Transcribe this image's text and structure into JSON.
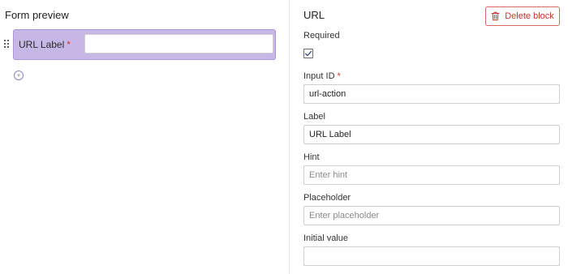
{
  "preview": {
    "title": "Form preview",
    "block": {
      "label": "URL Label",
      "required_mark": "*",
      "value": ""
    },
    "drag_icon": "drag-handle-icon",
    "add_icon": "add-circle-icon"
  },
  "editor": {
    "title": "URL",
    "delete_label": "Delete block",
    "delete_icon": "trash-icon",
    "required": {
      "label": "Required",
      "checked": true
    },
    "input_id": {
      "label": "Input ID",
      "required_mark": "*",
      "value": "url-action"
    },
    "label_field": {
      "label": "Label",
      "value": "URL Label"
    },
    "hint": {
      "label": "Hint",
      "placeholder": "Enter hint"
    },
    "placeholder_field": {
      "label": "Placeholder",
      "placeholder": "Enter placeholder"
    },
    "initial_value": {
      "label": "Initial value",
      "value": ""
    }
  },
  "colors": {
    "block_fill": "#c7b7e6",
    "delete_red": "#c0392b",
    "required_star": "#d23a3a"
  }
}
